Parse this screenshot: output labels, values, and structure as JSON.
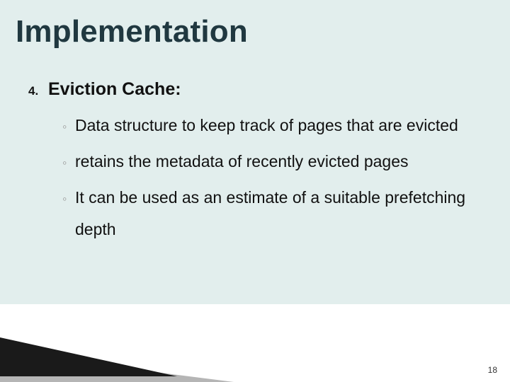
{
  "title": "Implementation",
  "list": {
    "marker": "4.",
    "heading": "Eviction Cache:",
    "bullets": [
      "Data structure to keep track of pages that are evicted",
      "retains the metadata of recently evicted pages",
      "It can be used as an estimate of a suitable prefetching depth"
    ]
  },
  "bullet_glyph": "◦",
  "page_number": "18"
}
